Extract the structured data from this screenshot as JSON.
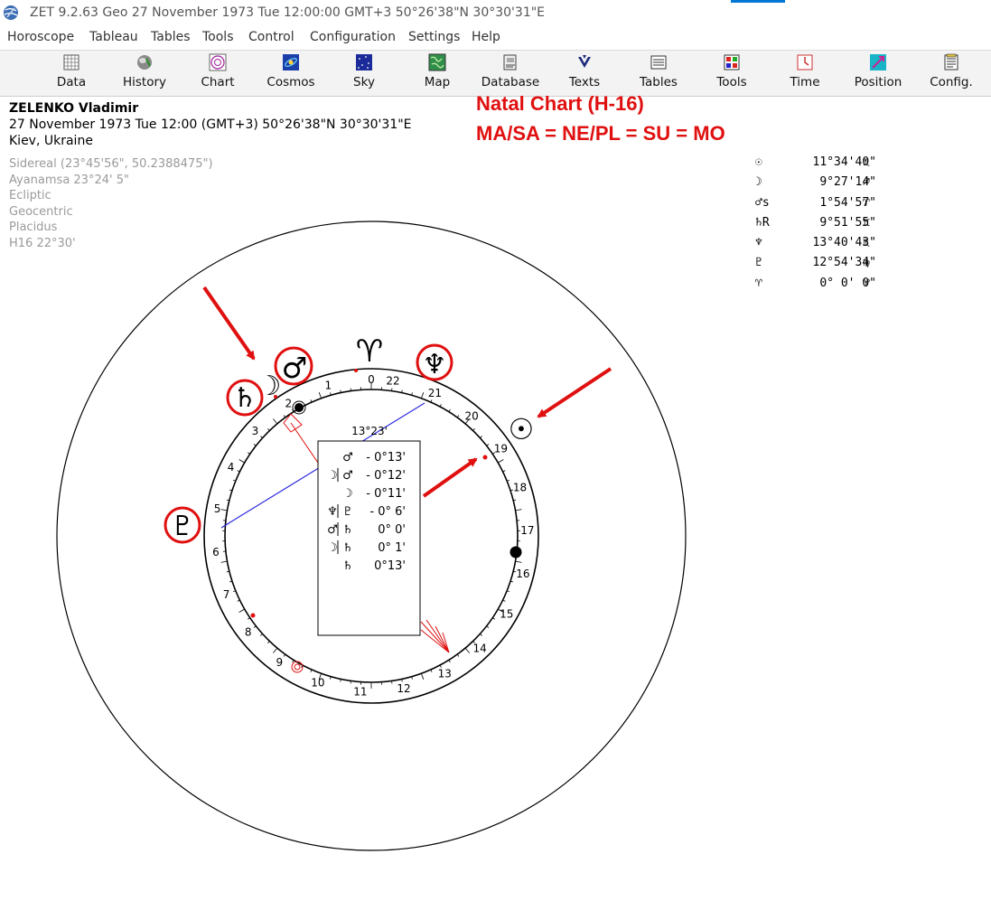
{
  "window": {
    "title": "ZET 9.2.63 Geo   27 November 1973  Tue  12:00:00 GMT+3 50°26'38\"N  30°30'31\"E"
  },
  "menu": [
    "Horoscope",
    "Tableau",
    "Tables",
    "Tools",
    "Control",
    "Configuration",
    "Settings",
    "Help"
  ],
  "toolbar": [
    {
      "label": "Data",
      "icon": "data-grid-icon"
    },
    {
      "label": "History",
      "icon": "history-icon"
    },
    {
      "label": "Chart",
      "icon": "chart-wheel-icon"
    },
    {
      "label": "Cosmos",
      "icon": "cosmos-icon"
    },
    {
      "label": "Sky",
      "icon": "sky-icon"
    },
    {
      "label": "Map",
      "icon": "map-icon"
    },
    {
      "label": "Database",
      "icon": "database-icon"
    },
    {
      "label": "Texts",
      "icon": "texts-icon"
    },
    {
      "label": "Tables",
      "icon": "tables-icon"
    },
    {
      "label": "Tools",
      "icon": "tools-icon"
    },
    {
      "label": "Time",
      "icon": "time-icon"
    },
    {
      "label": "Position",
      "icon": "position-icon"
    },
    {
      "label": "Config.",
      "icon": "config-icon"
    }
  ],
  "person": {
    "name": "ZELENKO Vladimir",
    "datetime": "27 November 1973  Tue  12:00 (GMT+3) 50°26'38\"N  30°30'31\"E",
    "place": "Kiev, Ukraine"
  },
  "settings": [
    "Sidereal (23°45'56\", 50.2388475\")",
    "Ayanamsa 23°24' 5\"",
    "Ecliptic",
    "Geocentric",
    "Placidus",
    "H16  22°30'"
  ],
  "annotation": {
    "line1": "Natal Chart (H-16)",
    "line2": "MA/SA = NE/PL = SU = MO"
  },
  "positions": [
    {
      "glyph": "☉",
      "value": "11°34'40\"",
      "sign": "♏"
    },
    {
      "glyph": "☽",
      "value": "9°27'14\"",
      "sign": "♐"
    },
    {
      "glyph": "♂s",
      "value": "1°54'57\"",
      "sign": "♈"
    },
    {
      "glyph": "♄R",
      "value": "9°51'55\"",
      "sign": "♊"
    },
    {
      "glyph": "♆",
      "value": "13°40'43\"",
      "sign": "♏"
    },
    {
      "glyph": "♇",
      "value": "12°54'34\"",
      "sign": "♍"
    },
    {
      "glyph": "♈",
      "value": "0° 0' 0\"",
      "sign": "♈"
    }
  ],
  "wheel": {
    "numbers": [
      "0",
      "1",
      "2",
      "3",
      "4",
      "5",
      "6",
      "7",
      "8",
      "9",
      "10",
      "11",
      "12",
      "13",
      "14",
      "15",
      "16",
      "17",
      "18",
      "19",
      "20",
      "21",
      "22"
    ],
    "planet_glyphs": {
      "aries": "♈",
      "sun": "☉",
      "moon": "☽",
      "mars": "♂",
      "saturn": "♄",
      "neptune": "♆",
      "pluto": "♇"
    }
  },
  "midpoint_box": {
    "header": "13°23'",
    "rows": [
      {
        "left": "",
        "right": "♂",
        "value": "- 0°13'"
      },
      {
        "left": "☽",
        "right": "♂",
        "value": "- 0°12'"
      },
      {
        "left": "",
        "right": "☽",
        "value": "- 0°11'"
      },
      {
        "left": "♆",
        "right": "♇",
        "value": "- 0° 6'"
      },
      {
        "left": "♂",
        "right": "♄",
        "value": "0° 0'"
      },
      {
        "left": "☽",
        "right": "♄",
        "value": "0° 1'"
      },
      {
        "left": "",
        "right": "♄",
        "value": "0°13'"
      }
    ]
  },
  "colors": {
    "annotation_red": "#e01010",
    "axis_blue": "#2a2ae0",
    "arrow_red": "#e01010"
  }
}
